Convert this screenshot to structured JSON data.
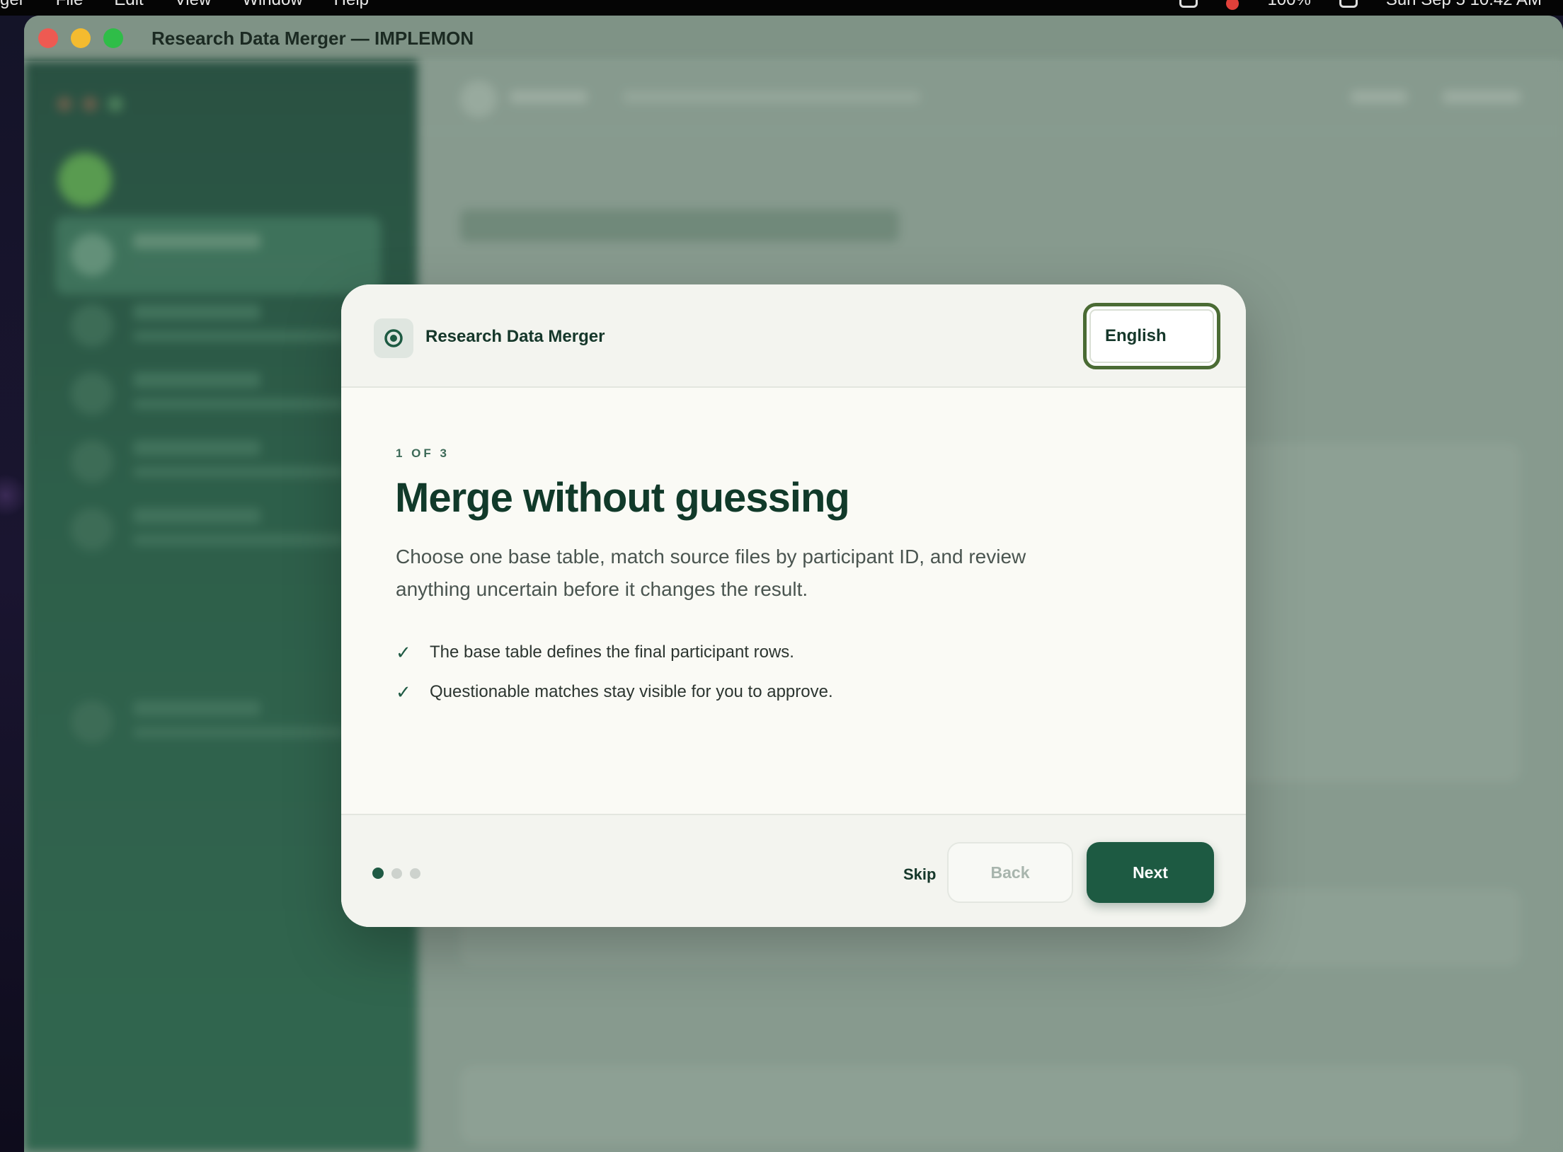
{
  "menubar": {
    "items": [
      "ger",
      "File",
      "Edit",
      "View",
      "Window",
      "Help"
    ],
    "clock": "Sun Sep 5  10:42 AM",
    "battery": "100%"
  },
  "window": {
    "title": "Research Data Merger — IMPLEMON"
  },
  "modal": {
    "app_name": "Research Data Merger",
    "language": {
      "selected": "English"
    },
    "step_label": "1 OF 3",
    "title": "Merge without guessing",
    "description": "Choose one base table, match source files by participant ID, and review anything uncertain before it changes the result.",
    "bullets": [
      "The base table defines the final participant rows.",
      "Questionable matches stay visible for you to approve."
    ],
    "pagination": {
      "current": 1,
      "total": 3
    },
    "buttons": {
      "skip": "Skip",
      "back": "Back",
      "next": "Next"
    }
  },
  "colors": {
    "accent": "#1d5a42",
    "focus_ring": "#4a6b34",
    "sidebar": "#0f3d2d"
  }
}
